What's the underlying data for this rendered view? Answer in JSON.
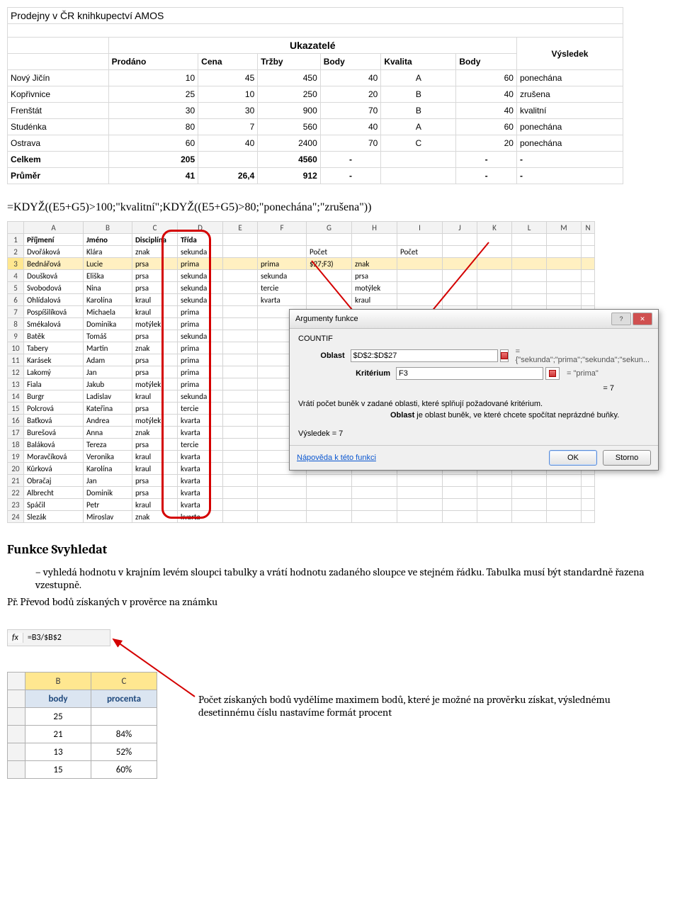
{
  "table1": {
    "title": "Prodejny v ČR knihkupectví AMOS",
    "group_header": "Ukazatelé",
    "result_header": "Výsledek",
    "cols": [
      "Prodáno",
      "Cena",
      "Tržby",
      "Body",
      "Kvalita",
      "Body"
    ],
    "rows": [
      {
        "name": "Nový Jičín",
        "vals": [
          "10",
          "45",
          "450",
          "40",
          "A",
          "60"
        ],
        "res": "ponechána"
      },
      {
        "name": "Kopřivnice",
        "vals": [
          "25",
          "10",
          "250",
          "20",
          "B",
          "40"
        ],
        "res": "zrušena"
      },
      {
        "name": "Frenštát",
        "vals": [
          "30",
          "30",
          "900",
          "70",
          "B",
          "40"
        ],
        "res": "kvalitní"
      },
      {
        "name": "Studénka",
        "vals": [
          "80",
          "7",
          "560",
          "40",
          "A",
          "60"
        ],
        "res": "ponechána"
      },
      {
        "name": "Ostrava",
        "vals": [
          "60",
          "40",
          "2400",
          "70",
          "C",
          "20"
        ],
        "res": "ponechána"
      }
    ],
    "totals": {
      "name": "Celkem",
      "vals": [
        "205",
        "",
        "4560",
        "-",
        "",
        "-"
      ],
      "res": "-"
    },
    "avg": {
      "name": "Průměr",
      "vals": [
        "41",
        "26,4",
        "912",
        "-",
        "",
        "-"
      ],
      "res": "-"
    }
  },
  "formula": "=KDYŽ((E5+G5)>100;\"kvalitní\";KDYŽ((E5+G5)>80;\"ponechána\";\"zrušena\"))",
  "sheet": {
    "cols": [
      "A",
      "B",
      "C",
      "D",
      "E",
      "F",
      "G",
      "H",
      "I",
      "J",
      "K",
      "L",
      "M",
      "N"
    ],
    "header": [
      "Příjmení",
      "Jméno",
      "Disciplína",
      "Třída"
    ],
    "aux": {
      "g2": "Počet",
      "i2": "Počet",
      "f_vals": [
        "prima",
        "sekunda",
        "tercie",
        "kvarta"
      ],
      "g3": "$27;F3)",
      "h_vals": [
        "znak",
        "prsa",
        "motýlek",
        "kraul"
      ]
    },
    "rows": [
      [
        "Dvořáková",
        "Klára",
        "znak",
        "sekunda"
      ],
      [
        "Bednářová",
        "Lucie",
        "prsa",
        "prima"
      ],
      [
        "Doušková",
        "Eliška",
        "prsa",
        "sekunda"
      ],
      [
        "Svobodová",
        "Nina",
        "prsa",
        "sekunda"
      ],
      [
        "Ohlídalová",
        "Karolína",
        "kraul",
        "sekunda"
      ],
      [
        "Pospíšilíková",
        "Michaela",
        "kraul",
        "prima"
      ],
      [
        "Smékalová",
        "Dominika",
        "motýlek",
        "prima"
      ],
      [
        "Batěk",
        "Tomáš",
        "prsa",
        "sekunda"
      ],
      [
        "Tabery",
        "Martin",
        "znak",
        "prima"
      ],
      [
        "Karásek",
        "Adam",
        "prsa",
        "prima"
      ],
      [
        "Lakomý",
        "Jan",
        "prsa",
        "prima"
      ],
      [
        "Fiala",
        "Jakub",
        "motýlek",
        "prima"
      ],
      [
        "Burgr",
        "Ladislav",
        "kraul",
        "sekunda"
      ],
      [
        "Polcrová",
        "Kateřina",
        "prsa",
        "tercie"
      ],
      [
        "Baťková",
        "Andrea",
        "motýlek",
        "kvarta"
      ],
      [
        "Burešová",
        "Anna",
        "znak",
        "kvarta"
      ],
      [
        "Baláková",
        "Tereza",
        "prsa",
        "tercie"
      ],
      [
        "Moravčíková",
        "Veronika",
        "kraul",
        "kvarta"
      ],
      [
        "Kůrková",
        "Karolína",
        "kraul",
        "kvarta"
      ],
      [
        "Obračaj",
        "Jan",
        "prsa",
        "kvarta"
      ],
      [
        "Albrecht",
        "Dominik",
        "prsa",
        "kvarta"
      ],
      [
        "Spáčil",
        "Petr",
        "kraul",
        "kvarta"
      ],
      [
        "Slezák",
        "Miroslav",
        "znak",
        "kvarta"
      ]
    ]
  },
  "dialog": {
    "title": "Argumenty funkce",
    "fn": "COUNTIF",
    "oblast_label": "Oblast",
    "oblast_val": "$D$2:$D$27",
    "oblast_eq": "= {\"sekunda\";\"prima\";\"sekunda\";\"sekun...",
    "krit_label": "Kritérium",
    "krit_val": "F3",
    "krit_eq": "= \"prima\"",
    "calc_eq": "= 7",
    "desc": "Vrátí počet buněk v zadané oblasti, které splňují požadované kritérium.",
    "desc2_label": "Oblast",
    "desc2": "je oblast buněk, ve které chcete spočítat neprázdné buňky.",
    "result_lbl": "Výsledek =  7",
    "help": "Nápověda k této funkci",
    "ok": "OK",
    "cancel": "Storno"
  },
  "section": {
    "heading": "Funkce Svyhledat",
    "bullet": "vyhledá hodnotu v krajním levém sloupci tabulky a vrátí hodnotu zadaného sloupce ve stejném řádku. Tabulka musí být standardně řazena vzestupně.",
    "para": "Př. Převod bodů získaných v prověrce na známku"
  },
  "bottom": {
    "fx": "=B3/$B$2",
    "cols": [
      "B",
      "C"
    ],
    "hdr": [
      "body",
      "procenta"
    ],
    "rows": [
      [
        "25",
        ""
      ],
      [
        "21",
        "84%"
      ],
      [
        "13",
        "52%"
      ],
      [
        "15",
        "60%"
      ]
    ],
    "para": "Počet získaných bodů vydělíme maximem bodů, které je možné na prověrku získat, výslednému desetinnému číslu nastavíme formát procent"
  }
}
